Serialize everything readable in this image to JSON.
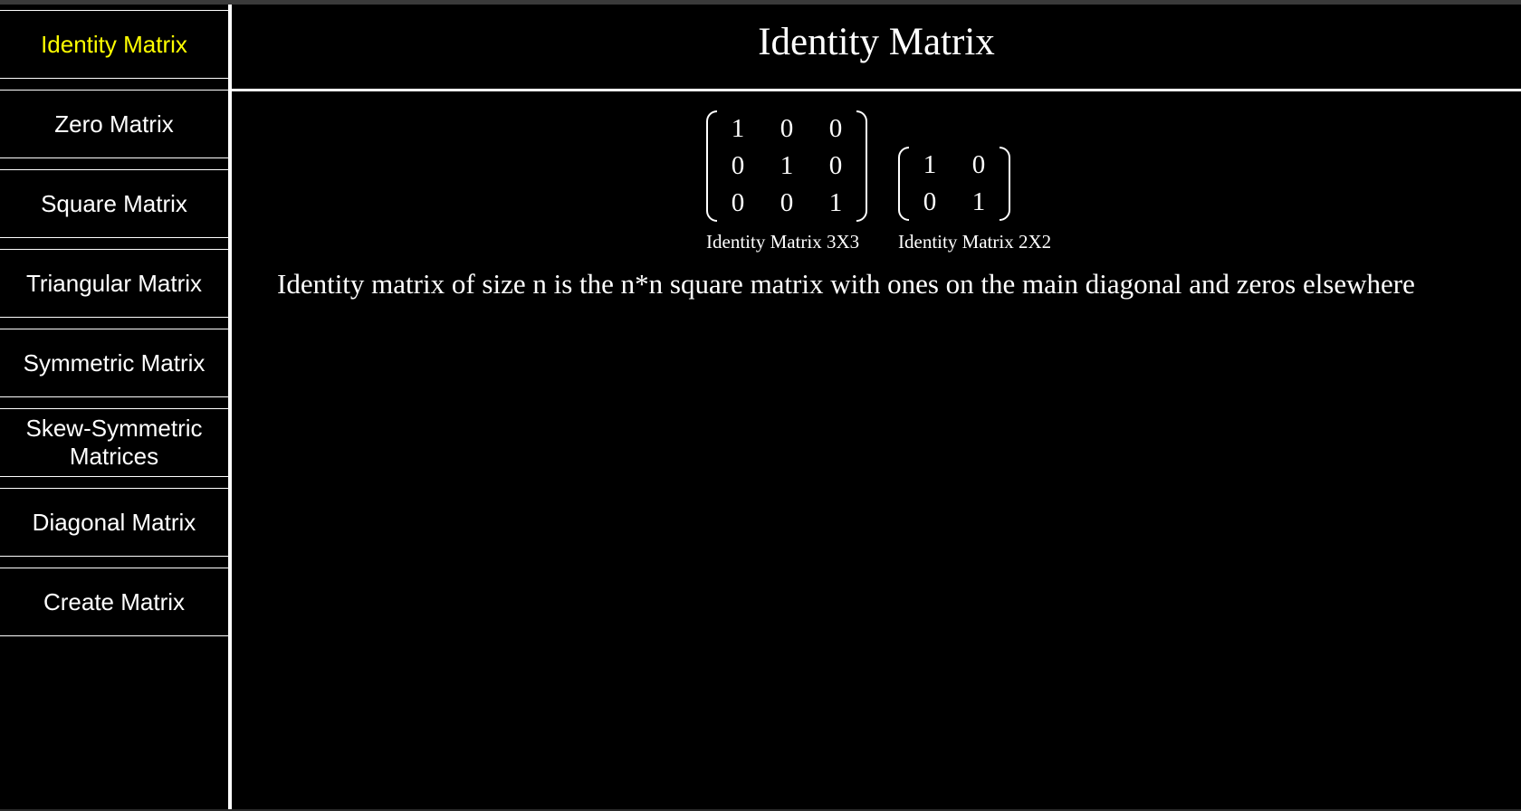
{
  "sidebar": {
    "items": [
      {
        "label": "Identity Matrix",
        "active": true
      },
      {
        "label": "Zero Matrix",
        "active": false
      },
      {
        "label": "Square Matrix",
        "active": false
      },
      {
        "label": "Triangular Matrix",
        "active": false
      },
      {
        "label": "Symmetric Matrix",
        "active": false
      },
      {
        "label": "Skew-Symmetric Matrices",
        "active": false
      },
      {
        "label": "Diagonal Matrix",
        "active": false
      },
      {
        "label": "Create Matrix",
        "active": false
      }
    ]
  },
  "header": {
    "title": "Identity Matrix"
  },
  "main": {
    "matrices": [
      {
        "caption": "Identity Matrix 3X3",
        "rows": [
          [
            "1",
            "0",
            "0"
          ],
          [
            "0",
            "1",
            "0"
          ],
          [
            "0",
            "0",
            "1"
          ]
        ]
      },
      {
        "caption": "Identity Matrix 2X2",
        "rows": [
          [
            "1",
            "0"
          ],
          [
            "0",
            "1"
          ]
        ]
      }
    ],
    "description": "Identity matrix of size n is the n*n square matrix with ones on the main diagonal and zeros elsewhere"
  },
  "colors": {
    "background": "#000000",
    "text": "#ffffff",
    "active": "#ffff00"
  }
}
